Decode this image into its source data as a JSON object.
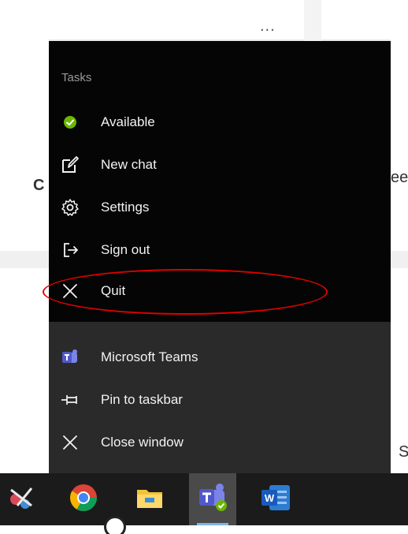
{
  "background": {
    "more_dots": "...",
    "fragment_left": "C",
    "fragment_right": "ee",
    "fragment_bottom_right": "S"
  },
  "jump_list": {
    "section_title": "Tasks",
    "tasks": [
      {
        "label": "Available",
        "icon": "available-status-icon"
      },
      {
        "label": "New chat",
        "icon": "new-chat-icon"
      },
      {
        "label": "Settings",
        "icon": "gear-icon"
      },
      {
        "label": "Sign out",
        "icon": "sign-out-icon"
      },
      {
        "label": "Quit",
        "icon": "close-icon"
      }
    ],
    "app_items": [
      {
        "label": "Microsoft Teams",
        "icon": "teams-icon"
      },
      {
        "label": "Pin to taskbar",
        "icon": "pin-icon"
      },
      {
        "label": "Close window",
        "icon": "close-icon"
      }
    ],
    "highlight_color": "#e00000"
  },
  "taskbar": {
    "apps": [
      {
        "name": "snipping-tool-icon"
      },
      {
        "name": "chrome-icon"
      },
      {
        "name": "file-explorer-icon"
      },
      {
        "name": "teams-icon",
        "active": true
      },
      {
        "name": "word-icon"
      }
    ],
    "active_underline_color": "#7fb3e8"
  }
}
